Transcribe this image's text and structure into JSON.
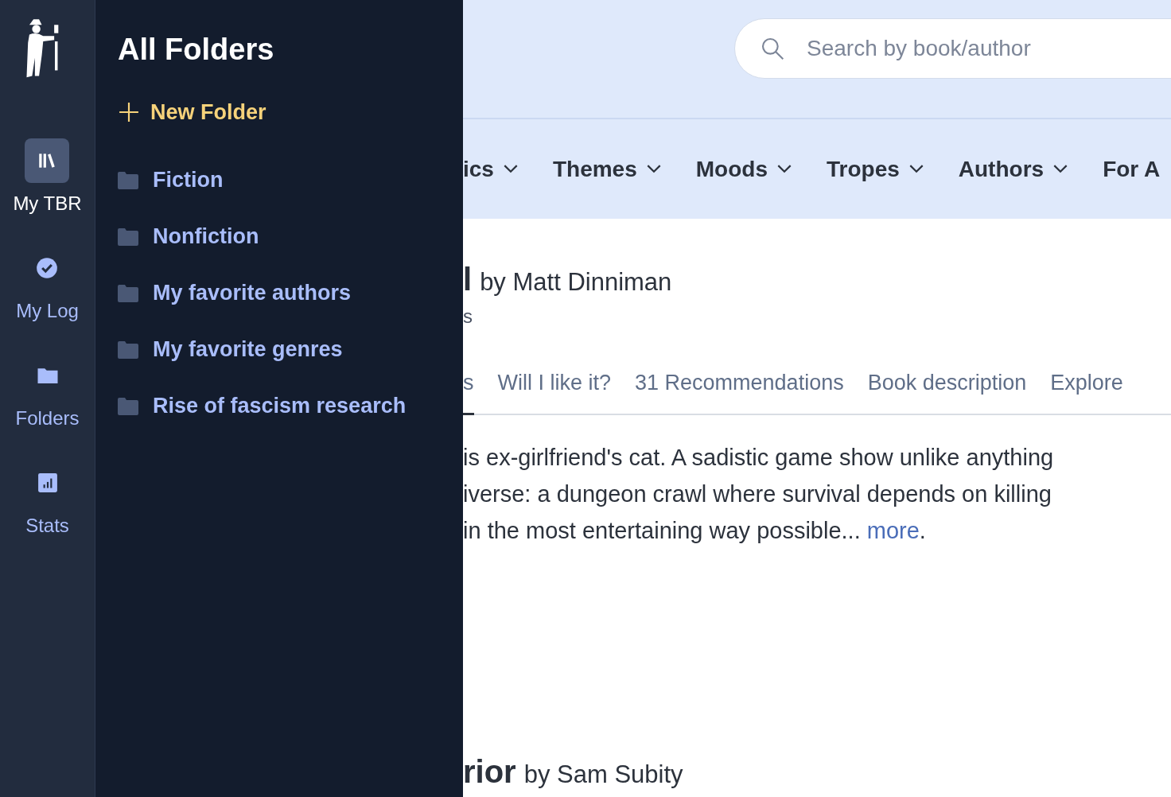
{
  "rail": {
    "items": [
      {
        "label": "My TBR",
        "kind": "books",
        "selected": true
      },
      {
        "label": "My Log",
        "kind": "check",
        "selected": false
      },
      {
        "label": "Folders",
        "kind": "folder",
        "selected": false
      },
      {
        "label": "Stats",
        "kind": "stats",
        "selected": false
      }
    ]
  },
  "drawer": {
    "title": "All Folders",
    "new_folder": "New Folder",
    "folders": [
      "Fiction",
      "Nonfiction",
      "My favorite authors",
      "My favorite genres",
      "Rise of fascism research"
    ]
  },
  "search": {
    "placeholder": "Search by book/author"
  },
  "nav": [
    {
      "label": "ics",
      "chevron": true
    },
    {
      "label": "Themes",
      "chevron": true
    },
    {
      "label": "Moods",
      "chevron": true
    },
    {
      "label": "Tropes",
      "chevron": true
    },
    {
      "label": "Authors",
      "chevron": true
    },
    {
      "label": "For A",
      "chevron": false
    }
  ],
  "books": [
    {
      "title": "l",
      "author": "by Matt Dinniman",
      "meta": "s",
      "tabs": [
        {
          "label": "s",
          "selected": true
        },
        {
          "label": "Will I like it?",
          "selected": false
        },
        {
          "label": "31 Recommendations",
          "selected": false
        },
        {
          "label": "Book description",
          "selected": false
        },
        {
          "label": "Explore",
          "selected": false
        }
      ],
      "description": [
        "is ex-girlfriend's cat. A sadistic game show unlike anything",
        "iverse: a dungeon crawl where survival depends on killing",
        "in the most entertaining way possible..."
      ],
      "more": "more",
      "end": "."
    },
    {
      "title": "rior",
      "author": "by Sam Subity"
    }
  ]
}
